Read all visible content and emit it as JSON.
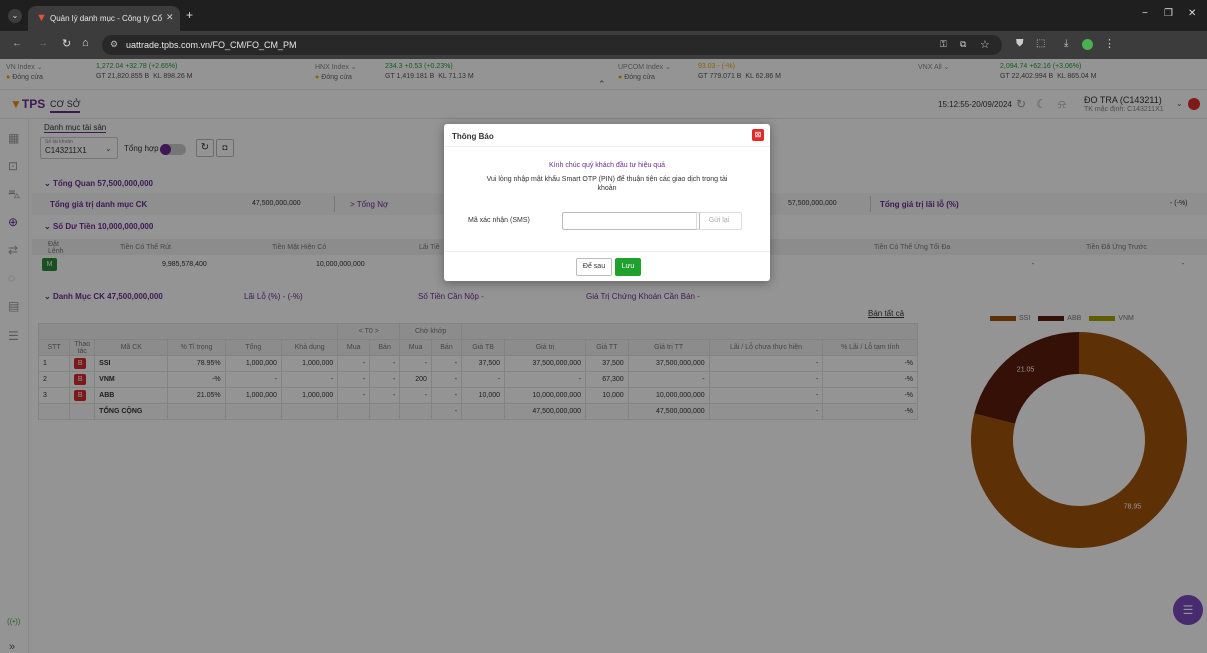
{
  "browser": {
    "tab_title": "Quản lý danh mục - Công ty Cổ",
    "url": "uattrade.tpbs.com.vn/FO_CM/FO_CM_PM"
  },
  "indices": [
    {
      "name": "VN Index",
      "value": "1,272.04",
      "change": "+32.78 (+2.65%)",
      "status": "Đóng cửa",
      "gt": "GT 21,820.855 B",
      "kl": "KL 898.26 M"
    },
    {
      "name": "HNX Index",
      "value": "234.3",
      "change": "+0.53 (+0.23%)",
      "status": "Đóng cửa",
      "gt": "GT 1,419.181 B",
      "kl": "KL 71.13 M"
    },
    {
      "name": "UPCOM Index",
      "value": "93.03",
      "change": "- (-%)",
      "status": "Đóng cửa",
      "gt": "GT 779.071 B",
      "kl": "KL 62.86 M"
    },
    {
      "name": "VNX All",
      "value": "2,094.74",
      "change": "+62.16 (+3.06%)",
      "status": "",
      "gt": "GT 22,402.994 B",
      "kl": "KL 865.04 M"
    }
  ],
  "header": {
    "logo": "TPS",
    "nav": "CƠ SỞ",
    "time": "15:12:55-20/09/2024",
    "user": "ĐO TRA (C143211)",
    "account_note": "TK mặc định: C143211X1"
  },
  "portfolio": {
    "title": "Danh mục tài sản",
    "account_label": "Số tài khoản",
    "account": "C143211X1",
    "total_label": "Tổng hợp",
    "overview": "Tổng Quan",
    "overview_value": "57,500,000,000",
    "total_assets_label": "Tổng giá trị danh mục CK",
    "total_assets": "47,500,000,000",
    "debt_label": "> Tổng Nợ",
    "right_value": "57,500,000,000",
    "pl_label": "Tổng giá trị lãi lỗ (%)",
    "pl_value": "- (-%)",
    "cash_label": "Số Dư Tiền",
    "cash_value": "10,000,000,000",
    "cash_headers": [
      "Đặt Lệnh",
      "Tiền Có Thể Rút",
      "Tiền Mặt Hiện Có",
      "Lãi Tiề",
      "Tiền Có Thể Ứng Tối Đa",
      "Tiền Đã Ứng Trước"
    ],
    "cash_order_btn": "M",
    "cash_withdraw": "9,985,578,400",
    "cash_current": "10,000,000,000",
    "cash_dash1": "-",
    "cash_dash2": "-",
    "sec_label": "Danh Mục CK",
    "sec_value": "47,500,000,000",
    "pl_pct_label": "Lãi Lỗ (%)",
    "pl_pct_value": "- (-%)",
    "pay_label": "Số Tiền Cần Nộp",
    "pay_value": "-",
    "sell_label": "Giá Trị Chứng Khoán Cần Bán",
    "sell_value": "-",
    "sell_all": "Bán tất cả"
  },
  "holdings": {
    "headers_top": {
      "t0": "< T0 >",
      "pending": "Chờ khớp"
    },
    "headers": [
      "STT",
      "Thao tác",
      "Mã CK",
      "% Tỉ trọng",
      "Tổng",
      "Khả dụng",
      "Mua",
      "Bán",
      "Mua",
      "Bán",
      "Giá TB",
      "Giá trị",
      "Giá TT",
      "Giá trị TT",
      "Lãi / Lỗ chưa thực hiện",
      "% Lãi / Lỗ tạm tính"
    ],
    "rows": [
      [
        "1",
        "B",
        "SSI",
        "78.95%",
        "1,000,000",
        "1,000,000",
        "-",
        "-",
        "-",
        "-",
        "37,500",
        "37,500,000,000",
        "37,500",
        "37,500,000,000",
        "-",
        "-%"
      ],
      [
        "2",
        "B",
        "VNM",
        "-%",
        "-",
        "-",
        "-",
        "-",
        "200",
        "-",
        "-",
        "-",
        "67,300",
        "-",
        "-",
        "-%"
      ],
      [
        "3",
        "B",
        "ABB",
        "21.05%",
        "1,000,000",
        "1,000,000",
        "-",
        "-",
        "-",
        "-",
        "10,000",
        "10,000,000,000",
        "10,000",
        "10,000,000,000",
        "-",
        "-%"
      ]
    ],
    "total_label": "TỔNG CỘNG",
    "total_pending": "-",
    "total_value": "47,500,000,000",
    "total_tt": "47,500,000,000",
    "total_pl": "-",
    "total_pct": "-%"
  },
  "chart_data": {
    "type": "pie",
    "categories": [
      "SSI",
      "ABB",
      "VNM"
    ],
    "values": [
      78.95,
      21.05,
      0
    ],
    "colors": [
      "#a0540a",
      "#5a1d0c",
      "#a3a000"
    ],
    "labels": [
      "78.95",
      "21.05"
    ]
  },
  "modal": {
    "title": "Thông Báo",
    "greeting": "Kính chúc quý khách đầu tư hiệu quả",
    "message": "Vui lòng nhập mật khẩu Smart OTP (PIN) để thuận tiện các giao dịch trong tài khoản",
    "code_label": "Mã xác nhận (SMS)",
    "code_value": "",
    "resend": "Gửi lại",
    "later": "Để sau",
    "save": "Lưu"
  }
}
